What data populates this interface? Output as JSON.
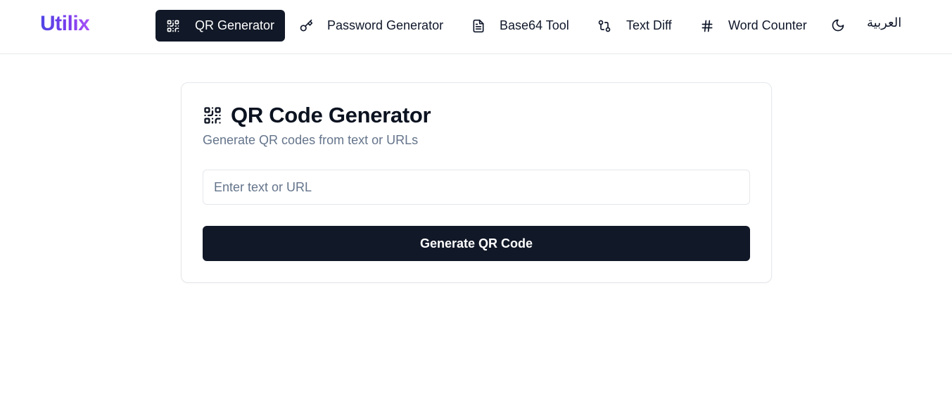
{
  "app": {
    "logo": "Utilix",
    "brand_colors": {
      "gradient_start": "#4f46e5",
      "gradient_end": "#a855f7"
    }
  },
  "nav": {
    "items": [
      {
        "label": "QR Generator",
        "icon": "qr-code-icon",
        "active": true
      },
      {
        "label": "Password Generator",
        "icon": "key-icon",
        "active": false
      },
      {
        "label": "Base64 Tool",
        "icon": "file-text-icon",
        "active": false
      },
      {
        "label": "Text Diff",
        "icon": "git-compare-icon",
        "active": false
      },
      {
        "label": "Word Counter",
        "icon": "hash-icon",
        "active": false
      }
    ],
    "theme_toggle_icon": "moon-icon",
    "language_toggle": "العربية"
  },
  "card": {
    "title": "QR Code Generator",
    "title_icon": "qr-code-icon",
    "subtitle": "Generate QR codes from text or URLs",
    "input": {
      "value": "",
      "placeholder": "Enter text or URL"
    },
    "button_label": "Generate QR Code"
  },
  "colors": {
    "primary_dark": "#111827",
    "muted_text": "#64748b",
    "border": "#e5e7eb"
  }
}
